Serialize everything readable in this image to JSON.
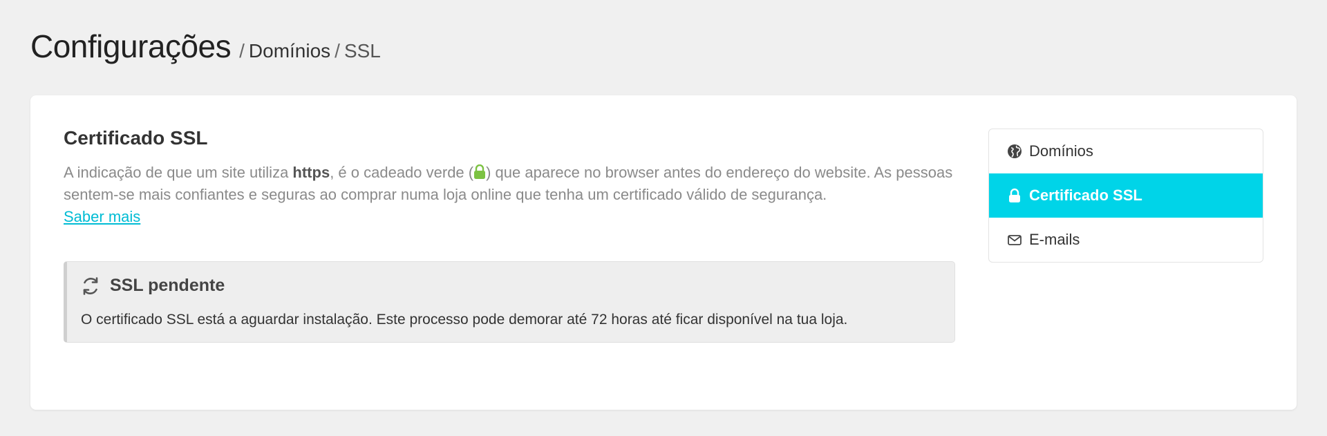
{
  "header": {
    "title": "Configurações",
    "breadcrumb": [
      {
        "label": "Domínios"
      },
      {
        "label": "SSL"
      }
    ],
    "separator": "/"
  },
  "ssl_section": {
    "title": "Certificado SSL",
    "description_before_https": "A indicação de que um site utiliza ",
    "https_word": "https",
    "description_before_lock": ", é o cadeado verde (",
    "description_after_lock": ") que aparece no browser antes do endereço do website. As pessoas sentem-se mais confiantes e seguras ao comprar numa loja online que tenha um certificado válido de segurança.",
    "learn_more": "Saber mais",
    "lock_color": "#7cc242"
  },
  "alert": {
    "icon": "refresh-icon",
    "title": "SSL pendente",
    "text": "O certificado SSL está a aguardar instalação. Este processo pode demorar até 72 horas até ficar disponível na tua loja."
  },
  "sidenav": {
    "items": [
      {
        "label": "Domínios",
        "icon": "globe-icon",
        "active": false
      },
      {
        "label": "Certificado SSL",
        "icon": "lock-icon",
        "active": true
      },
      {
        "label": "E-mails",
        "icon": "envelope-icon",
        "active": false
      }
    ],
    "active_color": "#00d4e8"
  }
}
